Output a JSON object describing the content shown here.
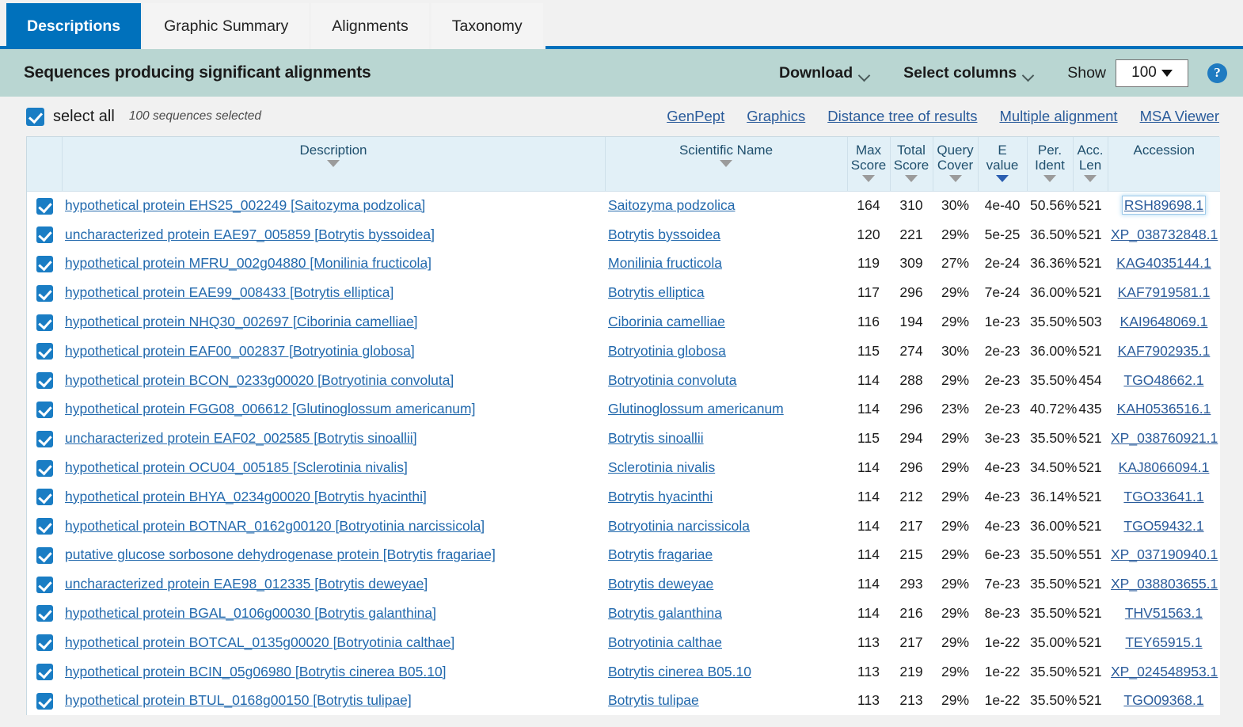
{
  "tabs": [
    {
      "label": "Descriptions",
      "active": true
    },
    {
      "label": "Graphic Summary",
      "active": false
    },
    {
      "label": "Alignments",
      "active": false
    },
    {
      "label": "Taxonomy",
      "active": false
    }
  ],
  "header": {
    "title": "Sequences producing significant alignments",
    "download_label": "Download",
    "select_columns_label": "Select columns",
    "show_label": "Show",
    "show_value": "100",
    "help_glyph": "?"
  },
  "select_bar": {
    "select_all_label": "select all",
    "selected_count_text": "100 sequences selected",
    "links": [
      "GenPept",
      "Graphics",
      "Distance tree of results",
      "Multiple alignment",
      "MSA Viewer"
    ]
  },
  "table": {
    "columns": [
      {
        "key": "chk",
        "label": "",
        "sortable": false
      },
      {
        "key": "desc",
        "label": "Description",
        "sortable": true
      },
      {
        "key": "sci",
        "label": "Scientific Name",
        "sortable": true
      },
      {
        "key": "max",
        "label": "Max\nScore",
        "line1": "Max",
        "line2": "Score",
        "sortable": true
      },
      {
        "key": "tot",
        "label": "Total\nScore",
        "line1": "Total",
        "line2": "Score",
        "sortable": true
      },
      {
        "key": "qc",
        "label": "Query\nCover",
        "line1": "Query",
        "line2": "Cover",
        "sortable": true
      },
      {
        "key": "ev",
        "label": "E\nvalue",
        "line1": "E",
        "line2": "value",
        "sortable": true,
        "sorted": true
      },
      {
        "key": "pi",
        "label": "Per.\nIdent",
        "line1": "Per.",
        "line2": "Ident",
        "sortable": true
      },
      {
        "key": "al",
        "label": "Acc.\nLen",
        "line1": "Acc.",
        "line2": "Len",
        "sortable": true
      },
      {
        "key": "acc",
        "label": "Accession",
        "sortable": false
      }
    ],
    "rows": [
      {
        "checked": true,
        "description": "hypothetical protein EHS25_002249 [Saitozyma podzolica]",
        "scientific_name": "Saitozyma podzolica",
        "max_score": "164",
        "total_score": "310",
        "query_cover": "30%",
        "e_value": "4e-40",
        "per_ident": "50.56%",
        "acc_len": "521",
        "accession": "RSH89698.1",
        "focused": true
      },
      {
        "checked": true,
        "description": "uncharacterized protein EAE97_005859 [Botrytis byssoidea]",
        "scientific_name": "Botrytis byssoidea",
        "max_score": "120",
        "total_score": "221",
        "query_cover": "29%",
        "e_value": "5e-25",
        "per_ident": "36.50%",
        "acc_len": "521",
        "accession": "XP_038732848.1",
        "focused": false
      },
      {
        "checked": true,
        "description": "hypothetical protein MFRU_002g04880 [Monilinia fructicola]",
        "scientific_name": "Monilinia fructicola",
        "max_score": "119",
        "total_score": "309",
        "query_cover": "27%",
        "e_value": "2e-24",
        "per_ident": "36.36%",
        "acc_len": "521",
        "accession": "KAG4035144.1",
        "focused": false
      },
      {
        "checked": true,
        "description": "hypothetical protein EAE99_008433 [Botrytis elliptica]",
        "scientific_name": "Botrytis elliptica",
        "max_score": "117",
        "total_score": "296",
        "query_cover": "29%",
        "e_value": "7e-24",
        "per_ident": "36.00%",
        "acc_len": "521",
        "accession": "KAF7919581.1",
        "focused": false
      },
      {
        "checked": true,
        "description": "hypothetical protein NHQ30_002697 [Ciborinia camelliae]",
        "scientific_name": "Ciborinia camelliae",
        "max_score": "116",
        "total_score": "194",
        "query_cover": "29%",
        "e_value": "1e-23",
        "per_ident": "35.50%",
        "acc_len": "503",
        "accession": "KAI9648069.1",
        "focused": false
      },
      {
        "checked": true,
        "description": "hypothetical protein EAF00_002837 [Botryotinia globosa]",
        "scientific_name": "Botryotinia globosa",
        "max_score": "115",
        "total_score": "274",
        "query_cover": "30%",
        "e_value": "2e-23",
        "per_ident": "36.00%",
        "acc_len": "521",
        "accession": "KAF7902935.1",
        "focused": false
      },
      {
        "checked": true,
        "description": "hypothetical protein BCON_0233g00020 [Botryotinia convoluta]",
        "scientific_name": "Botryotinia convoluta",
        "max_score": "114",
        "total_score": "288",
        "query_cover": "29%",
        "e_value": "2e-23",
        "per_ident": "35.50%",
        "acc_len": "454",
        "accession": "TGO48662.1",
        "focused": false
      },
      {
        "checked": true,
        "description": "hypothetical protein FGG08_006612 [Glutinoglossum americanum]",
        "scientific_name": "Glutinoglossum americanum",
        "max_score": "114",
        "total_score": "296",
        "query_cover": "23%",
        "e_value": "2e-23",
        "per_ident": "40.72%",
        "acc_len": "435",
        "accession": "KAH0536516.1",
        "focused": false
      },
      {
        "checked": true,
        "description": "uncharacterized protein EAF02_002585 [Botrytis sinoallii]",
        "scientific_name": "Botrytis sinoallii",
        "max_score": "115",
        "total_score": "294",
        "query_cover": "29%",
        "e_value": "3e-23",
        "per_ident": "35.50%",
        "acc_len": "521",
        "accession": "XP_038760921.1",
        "focused": false
      },
      {
        "checked": true,
        "description": "hypothetical protein OCU04_005185 [Sclerotinia nivalis]",
        "scientific_name": "Sclerotinia nivalis",
        "max_score": "114",
        "total_score": "296",
        "query_cover": "29%",
        "e_value": "4e-23",
        "per_ident": "34.50%",
        "acc_len": "521",
        "accession": "KAJ8066094.1",
        "focused": false
      },
      {
        "checked": true,
        "description": "hypothetical protein BHYA_0234g00020 [Botrytis hyacinthi]",
        "scientific_name": "Botrytis hyacinthi",
        "max_score": "114",
        "total_score": "212",
        "query_cover": "29%",
        "e_value": "4e-23",
        "per_ident": "36.14%",
        "acc_len": "521",
        "accession": "TGO33641.1",
        "focused": false
      },
      {
        "checked": true,
        "description": "hypothetical protein BOTNAR_0162g00120 [Botryotinia narcissicola]",
        "scientific_name": "Botryotinia narcissicola",
        "max_score": "114",
        "total_score": "217",
        "query_cover": "29%",
        "e_value": "4e-23",
        "per_ident": "36.00%",
        "acc_len": "521",
        "accession": "TGO59432.1",
        "focused": false
      },
      {
        "checked": true,
        "description": "putative glucose sorbosone dehydrogenase protein [Botrytis fragariae]",
        "scientific_name": "Botrytis fragariae",
        "max_score": "114",
        "total_score": "215",
        "query_cover": "29%",
        "e_value": "6e-23",
        "per_ident": "35.50%",
        "acc_len": "551",
        "accession": "XP_037190940.1",
        "focused": false
      },
      {
        "checked": true,
        "description": "uncharacterized protein EAE98_012335 [Botrytis deweyae]",
        "scientific_name": "Botrytis deweyae",
        "max_score": "114",
        "total_score": "293",
        "query_cover": "29%",
        "e_value": "7e-23",
        "per_ident": "35.50%",
        "acc_len": "521",
        "accession": "XP_038803655.1",
        "focused": false
      },
      {
        "checked": true,
        "description": "hypothetical protein BGAL_0106g00030 [Botrytis galanthina]",
        "scientific_name": "Botrytis galanthina",
        "max_score": "114",
        "total_score": "216",
        "query_cover": "29%",
        "e_value": "8e-23",
        "per_ident": "35.50%",
        "acc_len": "521",
        "accession": "THV51563.1",
        "focused": false
      },
      {
        "checked": true,
        "description": "hypothetical protein BOTCAL_0135g00020 [Botryotinia calthae]",
        "scientific_name": "Botryotinia calthae",
        "max_score": "113",
        "total_score": "217",
        "query_cover": "29%",
        "e_value": "1e-22",
        "per_ident": "35.00%",
        "acc_len": "521",
        "accession": "TEY65915.1",
        "focused": false
      },
      {
        "checked": true,
        "description": "hypothetical protein BCIN_05g06980 [Botrytis cinerea B05.10]",
        "scientific_name": "Botrytis cinerea B05.10",
        "max_score": "113",
        "total_score": "219",
        "query_cover": "29%",
        "e_value": "1e-22",
        "per_ident": "35.50%",
        "acc_len": "521",
        "accession": "XP_024548953.1",
        "focused": false
      },
      {
        "checked": true,
        "description": "hypothetical protein BTUL_0168g00150 [Botrytis tulipae]",
        "scientific_name": "Botrytis tulipae",
        "max_score": "113",
        "total_score": "213",
        "query_cover": "29%",
        "e_value": "1e-22",
        "per_ident": "35.50%",
        "acc_len": "521",
        "accession": "TGO09368.1",
        "focused": false
      }
    ]
  },
  "colors": {
    "tab_active": "#0071bc",
    "title_bar": "#b9d6d2",
    "table_header": "#e2f0f7",
    "link": "#2269ad",
    "checkbox": "#1a7dc4",
    "page_bg": "#f1f1f1"
  }
}
